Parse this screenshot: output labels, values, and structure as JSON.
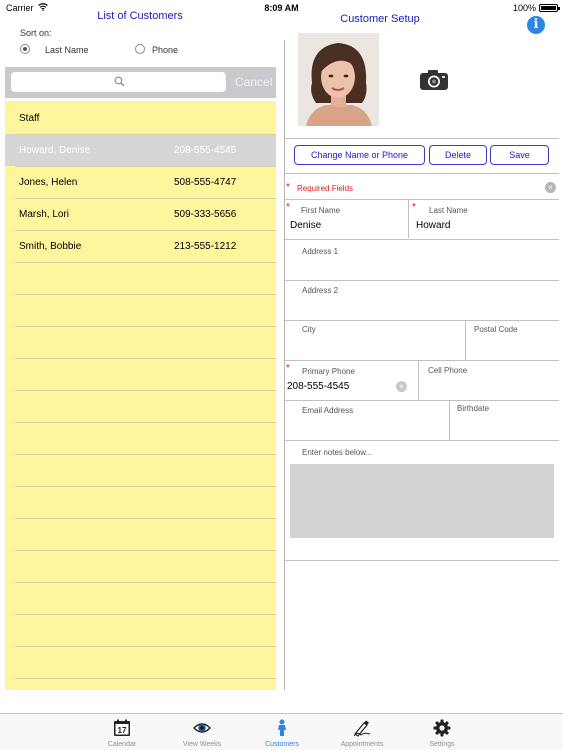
{
  "status": {
    "carrier": "Carrier",
    "time": "8:09 AM",
    "battery": "100%"
  },
  "left": {
    "title": "List of Customers",
    "sort_label": "Sort on:",
    "sort_options": [
      "Last Name",
      "Phone"
    ],
    "sort_selected": "Last Name",
    "search": {
      "placeholder": "",
      "cancel": "Cancel"
    },
    "rows": [
      {
        "name": "Staff",
        "phone": ""
      },
      {
        "name": "Howard, Denise",
        "phone": "208-555-4545",
        "selected": true
      },
      {
        "name": "Jones, Helen",
        "phone": "508-555-4747"
      },
      {
        "name": "Marsh, Lori",
        "phone": "509-333-5656"
      },
      {
        "name": "Smith, Bobbie",
        "phone": "213-555-1212"
      }
    ]
  },
  "right": {
    "title": "Customer Setup",
    "buttons": {
      "change": "Change Name or Phone",
      "delete": "Delete",
      "save": "Save"
    },
    "required_text": "Required Fields",
    "fields": {
      "first_name": {
        "label": "First Name",
        "value": "Denise"
      },
      "last_name": {
        "label": "Last Name",
        "value": "Howard"
      },
      "address1": {
        "label": "Address 1",
        "value": ""
      },
      "address2": {
        "label": "Address 2",
        "value": ""
      },
      "city": {
        "label": "City",
        "value": ""
      },
      "postal_code": {
        "label": "Postal Code",
        "value": ""
      },
      "primary_phone": {
        "label": "Primary Phone",
        "value": "208-555-4545"
      },
      "cell_phone": {
        "label": "Cell Phone",
        "value": ""
      },
      "email": {
        "label": "Email Address",
        "value": ""
      },
      "birthdate": {
        "label": "Birthdate",
        "value": ""
      }
    },
    "notes_label": "Enter notes below..."
  },
  "tabs": [
    {
      "label": "Calendar",
      "icon": "calendar-icon",
      "badge": "17"
    },
    {
      "label": "View Weeks",
      "icon": "eye-icon"
    },
    {
      "label": "Customers",
      "icon": "person-icon",
      "active": true
    },
    {
      "label": "Appointments",
      "icon": "pen-icon"
    },
    {
      "label": "Settings",
      "icon": "gear-icon"
    }
  ],
  "colors": {
    "accent": "#2e86de",
    "list_bg": "#fff59d",
    "title_blue": "#1a1ab8",
    "required_red": "#d42020"
  }
}
